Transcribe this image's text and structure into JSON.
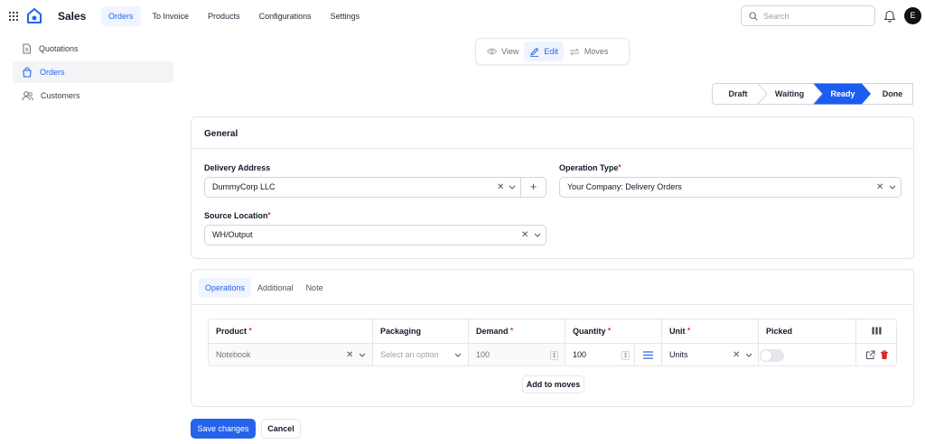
{
  "app": {
    "title": "Sales"
  },
  "nav": {
    "items": [
      {
        "label": "Orders"
      },
      {
        "label": "To Invoice"
      },
      {
        "label": "Products"
      },
      {
        "label": "Configurations"
      },
      {
        "label": "Settings"
      }
    ],
    "active": "Orders"
  },
  "search": {
    "placeholder": "Search"
  },
  "user": {
    "initial": "E"
  },
  "sidebar": {
    "items": [
      {
        "label": "Quotations",
        "icon": "document-icon"
      },
      {
        "label": "Orders",
        "icon": "shopping-bag-icon"
      },
      {
        "label": "Customers",
        "icon": "users-icon"
      }
    ],
    "active": "Orders"
  },
  "view_toggle": {
    "items": [
      {
        "label": "View",
        "icon": "eye-icon"
      },
      {
        "label": "Edit",
        "icon": "edit-icon"
      },
      {
        "label": "Moves",
        "icon": "arrows-icon"
      }
    ],
    "active": "Edit"
  },
  "stages": {
    "items": [
      "Draft",
      "Waiting",
      "Ready",
      "Done"
    ],
    "active": "Ready"
  },
  "general": {
    "title": "General",
    "delivery_address": {
      "label": "Delivery Address",
      "value": "DummyCorp LLC"
    },
    "operation_type": {
      "label": "Operation Type",
      "value": "Your Company: Delivery Orders",
      "required": true
    },
    "source_location": {
      "label": "Source Location",
      "value": "WH/Output",
      "required": true
    }
  },
  "operations": {
    "tabs": [
      "Operations",
      "Additional",
      "Note"
    ],
    "active_tab": "Operations",
    "columns": [
      "Product",
      "Packaging",
      "Demand",
      "Quantity",
      "Unit",
      "Picked"
    ],
    "required_columns": [
      "Product",
      "Demand",
      "Quantity",
      "Unit"
    ],
    "row": {
      "product": "Notebook",
      "packaging_placeholder": "Select an option",
      "demand": "100",
      "quantity": "100",
      "unit": "Units",
      "picked": false
    },
    "add_to_moves": "Add to moves"
  },
  "footer": {
    "save": "Save changes",
    "cancel": "Cancel"
  },
  "colors": {
    "accent": "#2563eb",
    "danger": "#dc2626",
    "stage_active": "#1d5cf0"
  }
}
